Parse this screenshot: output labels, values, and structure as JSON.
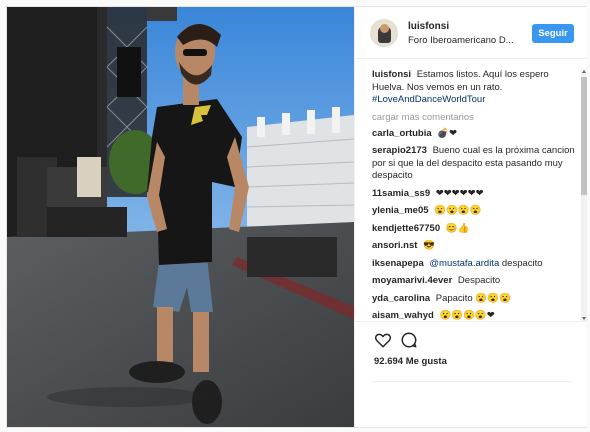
{
  "post": {
    "username": "luisfonsi",
    "location": "Foro Iberoamericano D...",
    "follow_label": "Seguir",
    "caption": {
      "user": "luisfonsi",
      "text": "Estamos listos. Aquí los espero Huelva. Nos vemos en un rato.",
      "hashtag": "#LoveAndDanceWorldTour"
    },
    "load_more": "cargar más comentarios",
    "comments": [
      {
        "user": "carla_ortubia",
        "text": "💣❤"
      },
      {
        "user": "serapio2173",
        "text": "Bueno cual es la próxima cancion por si que la del despacito esta pasando muy despacito"
      },
      {
        "user": "11samia_ss9",
        "text": "❤❤❤❤❤❤"
      },
      {
        "user": "ylenia_me05",
        "text": "😮😮😮😮"
      },
      {
        "user": "kendjette67750",
        "text": "😊👍"
      },
      {
        "user": "ansori.nst",
        "text": "😎"
      },
      {
        "user": "iksenapepa",
        "mention": "@mustafa.ardita",
        "text": "despacito"
      },
      {
        "user": "moyamarivi.4ever",
        "text": "Despacito"
      },
      {
        "user": "yda_carolina",
        "text": "Papacito 😮😮😮"
      },
      {
        "user": "aisam_wahyd",
        "text": "😮😮😮😮❤"
      }
    ],
    "likes": "92.694 Me gusta",
    "icons": [
      "heart-icon",
      "comment-icon"
    ],
    "colors": {
      "follow": "#3897f0",
      "link": "#003569",
      "muted": "#999999"
    }
  }
}
